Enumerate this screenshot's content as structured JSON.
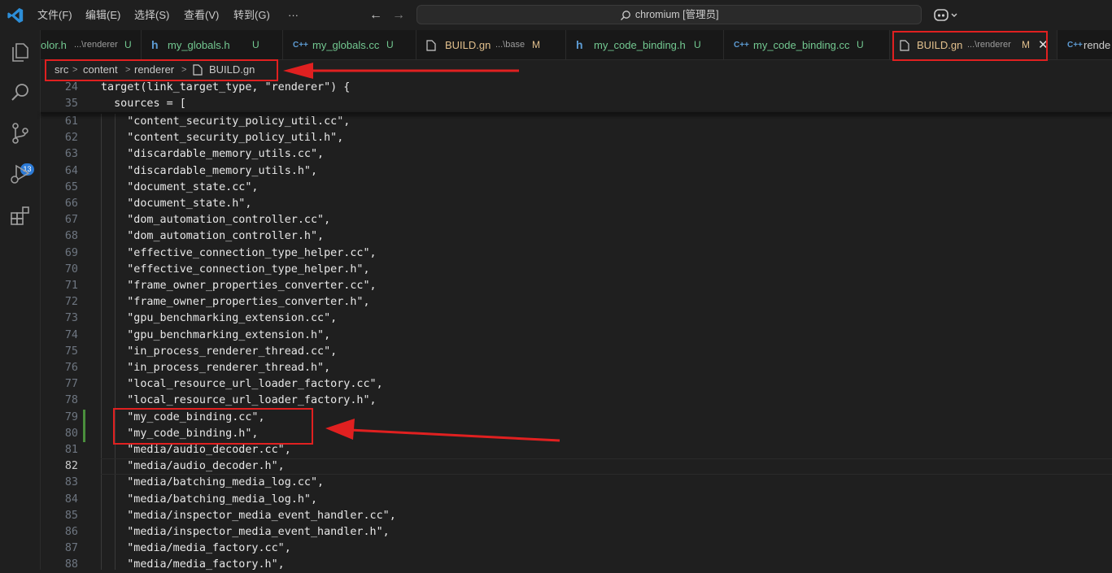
{
  "menu": [
    "文件(F)",
    "编辑(E)",
    "选择(S)",
    "查看(V)",
    "转到(G)",
    "···"
  ],
  "search": {
    "text": "chromium [管理员]"
  },
  "activity_bar": {
    "source_control_badge": "13",
    "icons": [
      "explorer-icon",
      "search-icon",
      "source-control-icon",
      "run-debug-icon",
      "extensions-icon"
    ]
  },
  "tabs": [
    {
      "icon": "",
      "name": "olor.h",
      "desc": "...\\renderer",
      "status": "U"
    },
    {
      "icon": "h",
      "name": "my_globals.h",
      "desc": "",
      "status": "U"
    },
    {
      "icon": "C++",
      "name": "my_globals.cc",
      "desc": "",
      "status": "U"
    },
    {
      "icon": "file",
      "name": "BUILD.gn",
      "desc": "...\\base",
      "status": "M"
    },
    {
      "icon": "h",
      "name": "my_code_binding.h",
      "desc": "",
      "status": "U"
    },
    {
      "icon": "C++",
      "name": "my_code_binding.cc",
      "desc": "",
      "status": "U"
    },
    {
      "icon": "file",
      "name": "BUILD.gn",
      "desc": "...\\renderer",
      "status": "M",
      "active": true
    },
    {
      "icon": "C++",
      "name": "rende",
      "desc": "",
      "status": ""
    }
  ],
  "status_colors": {
    "U": "#73c991",
    "M": "#e2c08d"
  },
  "breadcrumb": [
    "src",
    "content",
    "renderer",
    "BUILD.gn"
  ],
  "sticky_lines": [
    {
      "num": "24",
      "text": "target(link_target_type, \"renderer\") {"
    },
    {
      "num": "35",
      "text": "  sources = ["
    }
  ],
  "lines": [
    {
      "num": "61",
      "text": "    \"content_security_policy_util.cc\","
    },
    {
      "num": "62",
      "text": "    \"content_security_policy_util.h\","
    },
    {
      "num": "63",
      "text": "    \"discardable_memory_utils.cc\","
    },
    {
      "num": "64",
      "text": "    \"discardable_memory_utils.h\","
    },
    {
      "num": "65",
      "text": "    \"document_state.cc\","
    },
    {
      "num": "66",
      "text": "    \"document_state.h\","
    },
    {
      "num": "67",
      "text": "    \"dom_automation_controller.cc\","
    },
    {
      "num": "68",
      "text": "    \"dom_automation_controller.h\","
    },
    {
      "num": "69",
      "text": "    \"effective_connection_type_helper.cc\","
    },
    {
      "num": "70",
      "text": "    \"effective_connection_type_helper.h\","
    },
    {
      "num": "71",
      "text": "    \"frame_owner_properties_converter.cc\","
    },
    {
      "num": "72",
      "text": "    \"frame_owner_properties_converter.h\","
    },
    {
      "num": "73",
      "text": "    \"gpu_benchmarking_extension.cc\","
    },
    {
      "num": "74",
      "text": "    \"gpu_benchmarking_extension.h\","
    },
    {
      "num": "75",
      "text": "    \"in_process_renderer_thread.cc\","
    },
    {
      "num": "76",
      "text": "    \"in_process_renderer_thread.h\","
    },
    {
      "num": "77",
      "text": "    \"local_resource_url_loader_factory.cc\","
    },
    {
      "num": "78",
      "text": "    \"local_resource_url_loader_factory.h\","
    },
    {
      "num": "79",
      "text": "    \"my_code_binding.cc\",",
      "added": true
    },
    {
      "num": "80",
      "text": "    \"my_code_binding.h\",",
      "added": true
    },
    {
      "num": "81",
      "text": "    \"media/audio_decoder.cc\","
    },
    {
      "num": "82",
      "text": "    \"media/audio_decoder.h\",",
      "current": true
    },
    {
      "num": "83",
      "text": "    \"media/batching_media_log.cc\","
    },
    {
      "num": "84",
      "text": "    \"media/batching_media_log.h\","
    },
    {
      "num": "85",
      "text": "    \"media/inspector_media_event_handler.cc\","
    },
    {
      "num": "86",
      "text": "    \"media/inspector_media_event_handler.h\","
    },
    {
      "num": "87",
      "text": "    \"media/media_factory.cc\","
    },
    {
      "num": "88",
      "text": "    \"media/media_factory.h\","
    }
  ],
  "colors": {
    "accent": "#2c7ad6",
    "annotation": "#e02020",
    "added_bar": "#4a8f3c"
  }
}
